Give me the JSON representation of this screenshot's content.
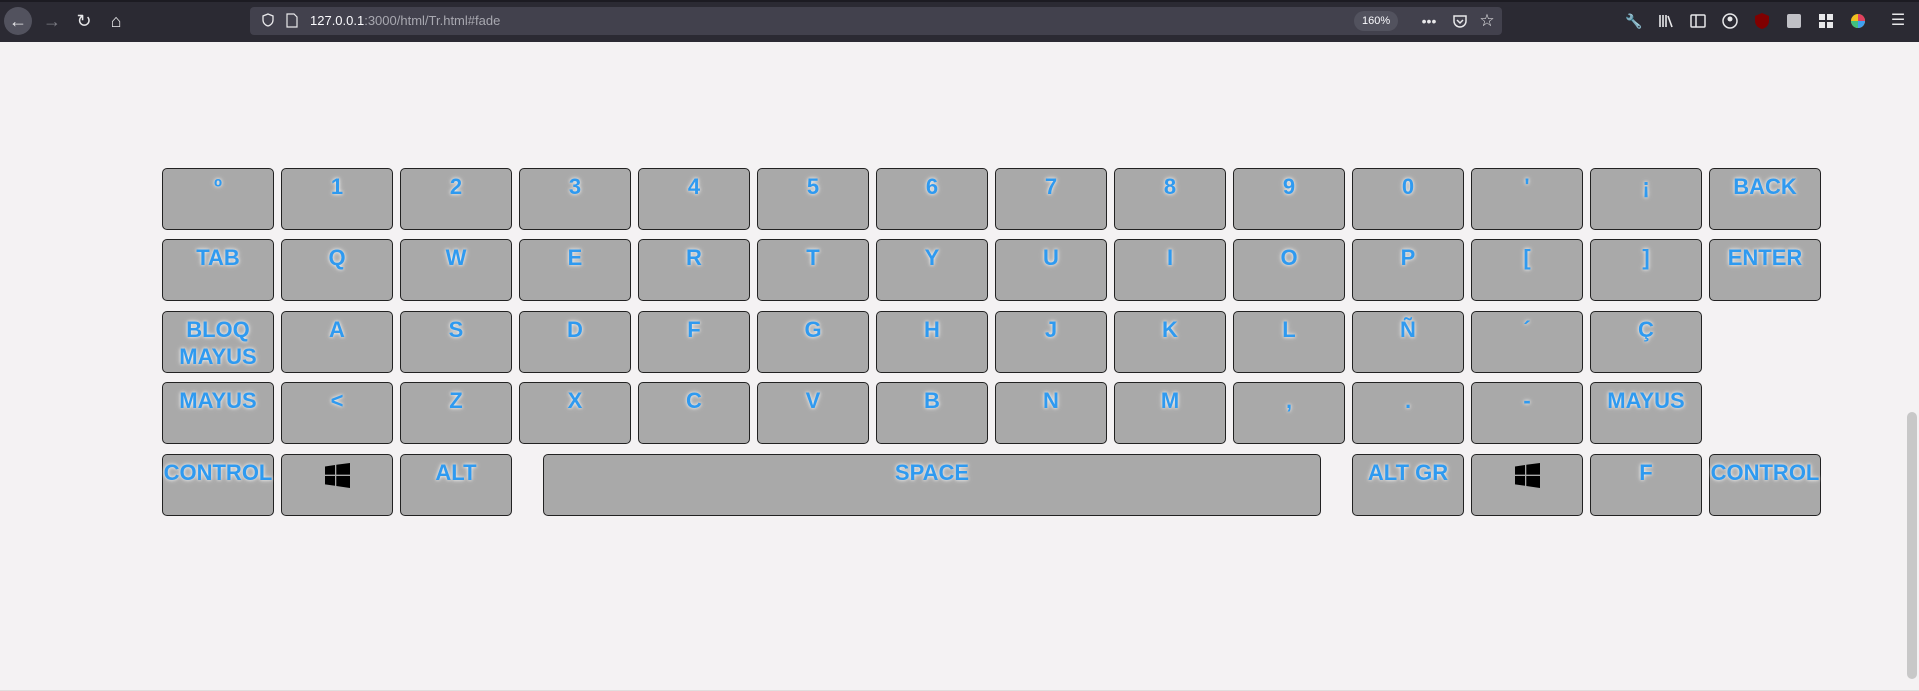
{
  "browser": {
    "url_host": "127.0.0.1",
    "url_rest": ":3000/html/Tr.html#fade",
    "zoom": "160%",
    "icons": [
      "back-icon",
      "forward-icon",
      "reload-icon",
      "home-icon",
      "shield-icon",
      "page-icon",
      "more-icon",
      "pocket-icon",
      "star-icon",
      "wrench-icon",
      "library-icon",
      "sidebar-icon",
      "account-icon",
      "ublock-icon",
      "extension-icon",
      "grid-icon",
      "color-icon",
      "menu-icon"
    ]
  },
  "keyboard": {
    "rows": [
      [
        "º",
        "1",
        "2",
        "3",
        "4",
        "5",
        "6",
        "7",
        "8",
        "9",
        "0",
        "'",
        "¡",
        "BACK"
      ],
      [
        "TAB",
        "Q",
        "W",
        "E",
        "R",
        "T",
        "Y",
        "U",
        "I",
        "O",
        "P",
        "[",
        "]",
        "ENTER"
      ],
      [
        "BLOQ MAYUS",
        "A",
        "S",
        "D",
        "F",
        "G",
        "H",
        "J",
        "K",
        "L",
        "Ñ",
        "´",
        "Ç"
      ],
      [
        "MAYUS",
        "<",
        "Z",
        "X",
        "C",
        "V",
        "B",
        "N",
        "M",
        ",",
        ".",
        "-",
        "MAYUS"
      ],
      [
        "CONTROL",
        "",
        "ALT",
        "SPACE",
        "ALT GR",
        "",
        "F",
        "CONTROL"
      ]
    ]
  },
  "colors": {
    "key_bg": "#a9a9a9",
    "key_text": "#2f9af0",
    "page_bg": "#f4f2f3",
    "toolbar_bg": "#2b2a33"
  }
}
